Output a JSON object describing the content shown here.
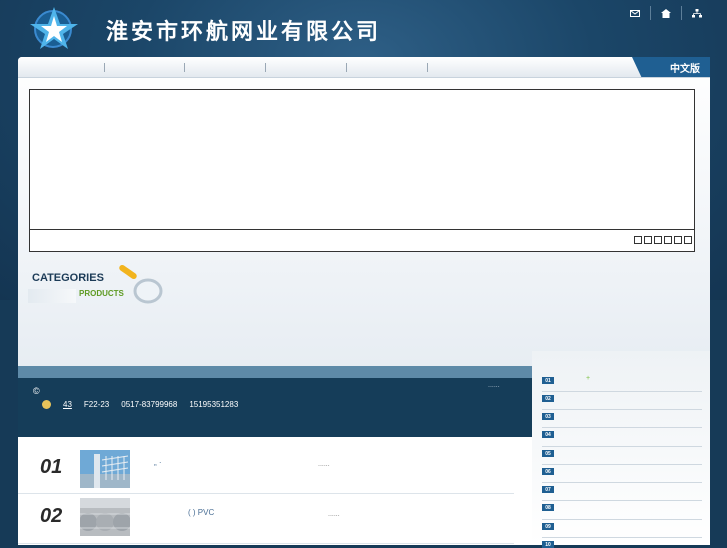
{
  "header": {
    "company_name": "淮安市环航网业有限公司",
    "icons": [
      "mail-icon",
      "home-icon",
      "sitemap-icon"
    ]
  },
  "nav": {
    "language_label": "中文版"
  },
  "categories": {
    "title": "CATEGORIES",
    "subtitle": "PRODUCTS"
  },
  "footer": {
    "copyright_symbol": "©",
    "address_number": "43",
    "address_unit": "F22-23",
    "phone": "0517-83799968",
    "mobile": "15195351283",
    "more": "......"
  },
  "sidebar": {
    "numbers": [
      "01",
      "02",
      "03",
      "04",
      "05",
      "06",
      "07",
      "08",
      "09",
      "10"
    ],
    "plus": "+"
  },
  "list": {
    "items": [
      {
        "num": "01",
        "text": "„ ·",
        "more": "......"
      },
      {
        "num": "02",
        "text": "( )    PVC",
        "more": "......"
      }
    ]
  },
  "colors": {
    "accent": "#1f5f92",
    "green": "#5e9a23",
    "dark_bg": "#163a57"
  }
}
